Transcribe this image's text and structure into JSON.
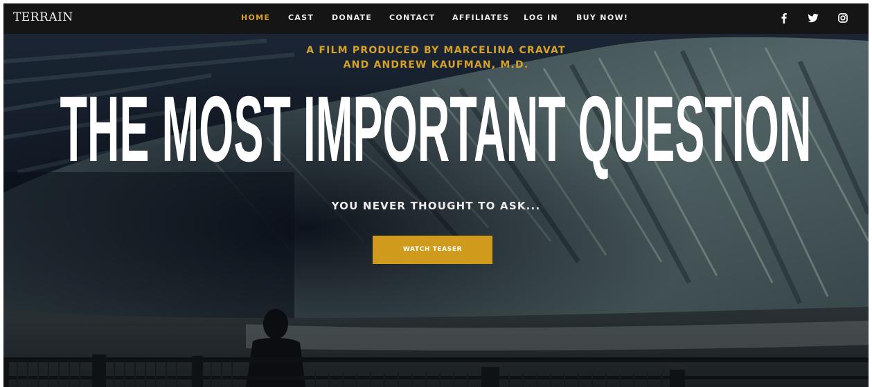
{
  "header": {
    "logo": "TERRAIN",
    "nav": [
      {
        "label": "HOME",
        "active": true
      },
      {
        "label": "CAST",
        "active": false
      },
      {
        "label": "DONATE",
        "active": false
      },
      {
        "label": "CONTACT",
        "active": false
      },
      {
        "label": "AFFILIATES",
        "active": false
      },
      {
        "label": "LOG IN",
        "active": false
      },
      {
        "label": "BUY NOW!",
        "active": false
      }
    ],
    "social": [
      {
        "icon": "facebook-icon"
      },
      {
        "icon": "twitter-icon"
      },
      {
        "icon": "instagram-icon"
      }
    ]
  },
  "hero": {
    "producer_line1": "A FILM PRODUCED BY MARCELINA CRAVAT",
    "producer_line2": "AND ANDREW KAUFMAN, M.D.",
    "title": "THE MOST IMPORTANT QUESTION",
    "tagline": "YOU NEVER THOUGHT TO ASK...",
    "cta_label": "WATCH TEASER"
  },
  "colors": {
    "accent": "#d4a12a",
    "button": "#d09b1c",
    "nav_background": "#151515",
    "nav_text": "#ececec",
    "title_text": "#ffffff"
  }
}
